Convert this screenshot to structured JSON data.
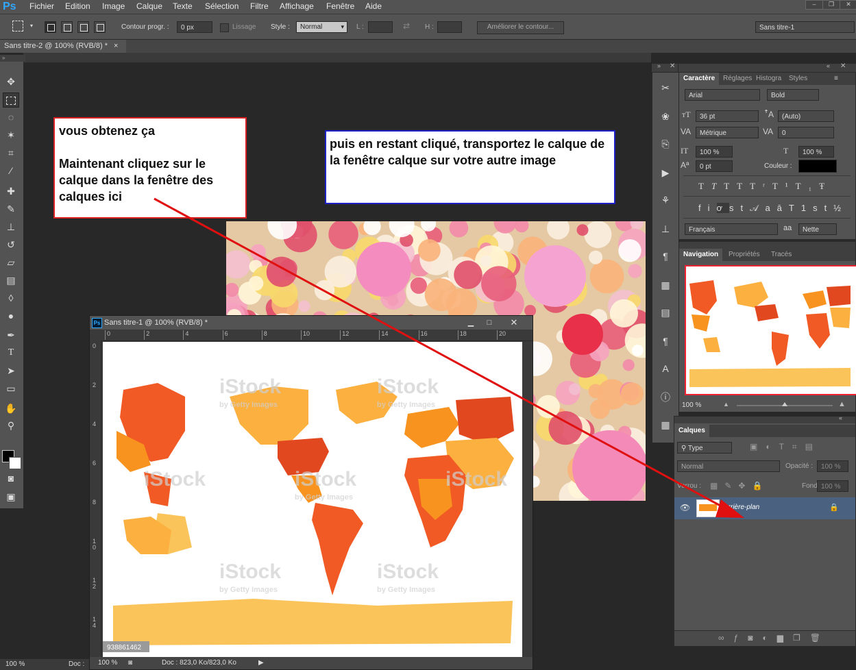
{
  "app": {
    "logo": "Ps"
  },
  "menu": [
    "Fichier",
    "Edition",
    "Image",
    "Calque",
    "Texte",
    "Sélection",
    "Filtre",
    "Affichage",
    "Fenêtre",
    "Aide"
  ],
  "options": {
    "contour_label": "Contour progr. :",
    "contour_value": "0 px",
    "lissage_label": "Lissage",
    "style_label": "Style :",
    "style_value": "Normal",
    "l_label": "L :",
    "h_label": "H :",
    "refine_button": "Améliorer le contour...",
    "workspace": "Sans titre-1"
  },
  "tabs": {
    "active": "Sans titre-2 @ 100% (RVB/8) *",
    "close": "×"
  },
  "status": {
    "zoom": "100 %",
    "doc": "Doc :"
  },
  "callouts": {
    "left_line1": "vous obtenez ça",
    "left_line2": "Maintenant cliquez sur le calque dans la fenêtre des calques ici",
    "right": "puis en restant cliqué, transportez le calque de la fenêtre calque sur votre autre image"
  },
  "docwindow": {
    "title": "Sans titre-1 @ 100% (RVB/8) *",
    "hruler": [
      "0",
      "2",
      "4",
      "6",
      "8",
      "10",
      "12",
      "14",
      "16",
      "18",
      "20"
    ],
    "vruler": [
      "0",
      "2",
      "4",
      "6",
      "8",
      "10",
      "12",
      "14"
    ],
    "zoom": "100 %",
    "doc_info": "Doc : 823,0 Ko/823,0 Ko",
    "watermark": "iStock",
    "watermark_sub": "by Getty Images",
    "stock_id": "938861462"
  },
  "character": {
    "tabs": [
      "Caractère",
      "Réglages",
      "Histogra",
      "Styles"
    ],
    "font": "Arial",
    "style": "Bold",
    "size": "36 pt",
    "leading": "(Auto)",
    "kerning": "Métrique",
    "tracking": "0",
    "vscale": "100 %",
    "hscale": "100 %",
    "baseline": "0 pt",
    "color_label": "Couleur :",
    "language": "Français",
    "aa_label": "aa",
    "antialias": "Nette"
  },
  "navigation": {
    "tabs": [
      "Navigation",
      "Propriétés",
      "Tracés"
    ],
    "zoom": "100 %"
  },
  "layers": {
    "title": "Calques",
    "filter": "Type",
    "blend": "Normal",
    "opacity_label": "Opacité :",
    "opacity": "100 %",
    "lock_label": "Verrou :",
    "fill_label": "Fond :",
    "fill": "100 %",
    "layer_name": "Arrière-plan"
  }
}
